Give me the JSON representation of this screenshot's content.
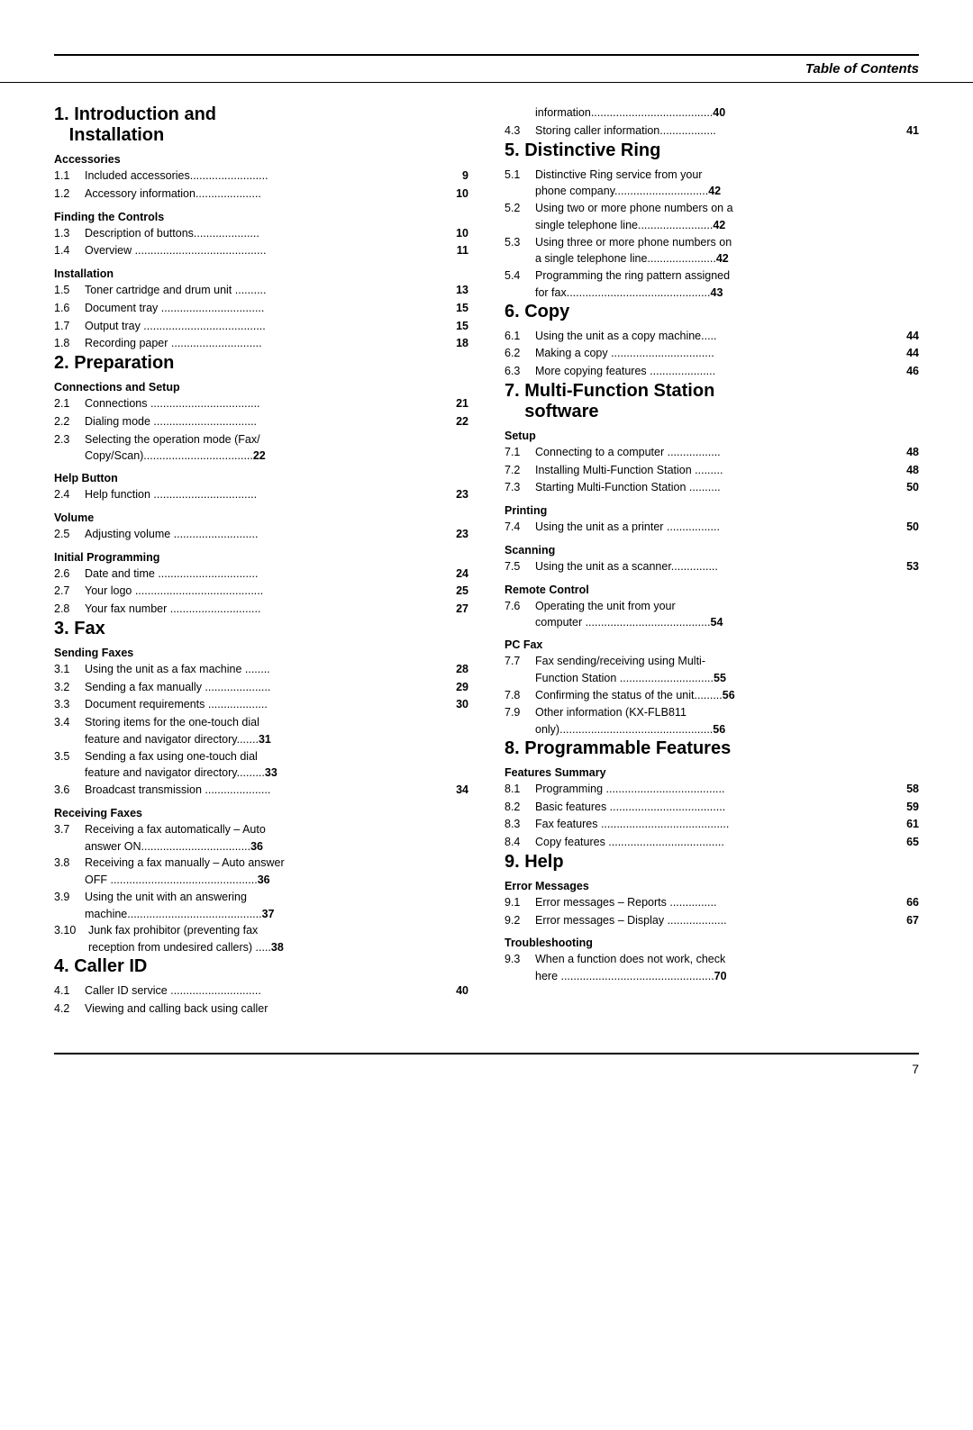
{
  "header": {
    "title": "Table of Contents"
  },
  "footer": {
    "page_number": "7"
  },
  "left_column": {
    "sections": [
      {
        "id": "section1",
        "number": "1.",
        "title": "Introduction and\n    Installation",
        "subsections": [
          {
            "label": "Accessories",
            "entries": [
              {
                "num": "1.1",
                "text": "Included accessories",
                "dots": ".........................",
                "page": "9"
              },
              {
                "num": "1.2",
                "text": "Accessory information",
                "dots": ".....................",
                "page": "10"
              }
            ]
          },
          {
            "label": "Finding the Controls",
            "entries": [
              {
                "num": "1.3",
                "text": "Description of buttons",
                "dots": ".....................",
                "page": "10"
              },
              {
                "num": "1.4",
                "text": "Overview",
                "dots": "....................................",
                "page": "11"
              }
            ]
          },
          {
            "label": "Installation",
            "entries": [
              {
                "num": "1.5",
                "text": "Toner cartridge and drum unit",
                "dots": ".........",
                "page": "13",
                "multiline": false
              },
              {
                "num": "1.6",
                "text": "Document tray",
                "dots": "............................",
                "page": "15"
              },
              {
                "num": "1.7",
                "text": "Output tray",
                "dots": "...............................",
                "page": "15"
              },
              {
                "num": "1.8",
                "text": "Recording paper",
                "dots": ".......................",
                "page": "18"
              }
            ]
          }
        ]
      },
      {
        "id": "section2",
        "number": "2.",
        "title": "Preparation",
        "subsections": [
          {
            "label": "Connections and Setup",
            "entries": [
              {
                "num": "2.1",
                "text": "Connections",
                "dots": ".................................",
                "page": "21"
              },
              {
                "num": "2.2",
                "text": "Dialing mode",
                "dots": "............................",
                "page": "22"
              },
              {
                "num": "2.3",
                "text": "Selecting the operation mode (Fax/\n        Copy/Scan)",
                "dots": "............................",
                "page": "22",
                "multiline": true
              }
            ]
          },
          {
            "label": "Help Button",
            "entries": [
              {
                "num": "2.4",
                "text": "Help function",
                "dots": "...............................",
                "page": "23"
              }
            ]
          },
          {
            "label": "Volume",
            "entries": [
              {
                "num": "2.5",
                "text": "Adjusting volume",
                "dots": ".....................",
                "page": "23"
              }
            ]
          },
          {
            "label": "Initial Programming",
            "entries": [
              {
                "num": "2.6",
                "text": "Date and time",
                "dots": "............................",
                "page": "24"
              },
              {
                "num": "2.7",
                "text": "Your logo",
                "dots": "...................................",
                "page": "25"
              },
              {
                "num": "2.8",
                "text": "Your fax number",
                "dots": ".....................",
                "page": "27"
              }
            ]
          }
        ]
      },
      {
        "id": "section3",
        "number": "3.",
        "title": "Fax",
        "subsections": [
          {
            "label": "Sending Faxes",
            "entries": [
              {
                "num": "3.1",
                "text": "Using the unit as a fax machine",
                "dots": ".......",
                "page": "28",
                "multiline": false
              },
              {
                "num": "3.2",
                "text": "Sending a fax manually",
                "dots": "...................",
                "page": "29"
              },
              {
                "num": "3.3",
                "text": "Document requirements",
                "dots": ".................",
                "page": "30"
              },
              {
                "num": "3.4",
                "text": "Storing items for the one-touch dial\n        feature and navigator directory",
                "dots": ".",
                "page": "31",
                "multiline": true
              },
              {
                "num": "3.5",
                "text": "Sending a fax using one-touch dial\n        feature and navigator directory",
                "dots": ".........",
                "page": "33",
                "multiline": true
              },
              {
                "num": "3.6",
                "text": "Broadcast transmission",
                "dots": ".................",
                "page": "34"
              }
            ]
          },
          {
            "label": "Receiving Faxes",
            "entries": [
              {
                "num": "3.7",
                "text": "Receiving a fax automatically – Auto\n        answer ON",
                "dots": ".................................",
                "page": "36",
                "multiline": true
              },
              {
                "num": "3.8",
                "text": "Receiving a fax manually – Auto answer\n        OFF",
                "dots": ".................................",
                "page": "36",
                "multiline": true
              },
              {
                "num": "3.9",
                "text": "Using the unit with an answering\n        machine",
                "dots": ".......................................",
                "page": "37",
                "multiline": true
              },
              {
                "num": "3.10",
                "text": "Junk fax prohibitor (preventing fax\n        reception from undesired callers)",
                "dots": ".....",
                "page": "38",
                "multiline": true
              }
            ]
          }
        ]
      },
      {
        "id": "section4",
        "number": "4.",
        "title": "Caller ID",
        "subsections": [
          {
            "label": "",
            "entries": [
              {
                "num": "4.1",
                "text": "Caller ID service",
                "dots": ".....................",
                "page": "40"
              },
              {
                "num": "4.2",
                "text": "Viewing and calling back using caller\n        information",
                "dots": "............................",
                "page": "40",
                "multiline": true
              }
            ]
          }
        ]
      }
    ]
  },
  "right_column": {
    "sections": [
      {
        "id": "section4cont",
        "entries_cont": [
          {
            "num": "4.3",
            "text": "Storing caller information",
            "dots": "................",
            "page": "41"
          }
        ]
      },
      {
        "id": "section5",
        "number": "5.",
        "title": "Distinctive Ring",
        "subsections": [
          {
            "label": "",
            "entries": [
              {
                "num": "5.1",
                "text": "Distinctive Ring service from your\n        phone company",
                "dots": ".......................",
                "page": "42",
                "multiline": true
              },
              {
                "num": "5.2",
                "text": "Using two or more phone numbers on a\n        single telephone line",
                "dots": "...................",
                "page": "42",
                "multiline": true
              },
              {
                "num": "5.3",
                "text": "Using three or more phone numbers on\n        a single telephone line",
                "dots": ".....................",
                "page": "42",
                "multiline": true
              },
              {
                "num": "5.4",
                "text": "Programming the ring pattern assigned\n        for fax",
                "dots": "...........................................",
                "page": "43",
                "multiline": true
              }
            ]
          }
        ]
      },
      {
        "id": "section6",
        "number": "6.",
        "title": "Copy",
        "subsections": [
          {
            "label": "",
            "entries": [
              {
                "num": "6.1",
                "text": "Using the unit as a copy machine",
                "dots": ".....",
                "page": "44"
              },
              {
                "num": "6.2",
                "text": "Making a copy",
                "dots": "............................",
                "page": "44"
              },
              {
                "num": "6.3",
                "text": "More copying features",
                "dots": "...................",
                "page": "46"
              }
            ]
          }
        ]
      },
      {
        "id": "section7",
        "number": "7.",
        "title": "Multi-Function Station\n    software",
        "subsections": [
          {
            "label": "Setup",
            "entries": [
              {
                "num": "7.1",
                "text": "Connecting to a computer",
                "dots": ".............",
                "page": "48"
              },
              {
                "num": "7.2",
                "text": "Installing Multi-Function Station",
                "dots": ".......",
                "page": "48"
              },
              {
                "num": "7.3",
                "text": "Starting Multi-Function Station",
                "dots": ".........",
                "page": "50"
              }
            ]
          },
          {
            "label": "Printing",
            "entries": [
              {
                "num": "7.4",
                "text": "Using the unit as a printer",
                "dots": ".............",
                "page": "50"
              }
            ]
          },
          {
            "label": "Scanning",
            "entries": [
              {
                "num": "7.5",
                "text": "Using the unit as a scanner",
                "dots": "...........",
                "page": "53"
              }
            ]
          },
          {
            "label": "Remote Control",
            "entries": [
              {
                "num": "7.6",
                "text": "Operating the unit from your\n        computer",
                "dots": ".................................",
                "page": "54",
                "multiline": true
              }
            ]
          },
          {
            "label": "PC Fax",
            "entries": [
              {
                "num": "7.7",
                "text": "Fax sending/receiving using Multi-\n        Function Station",
                "dots": ".......................",
                "page": "55",
                "multiline": true
              },
              {
                "num": "7.8",
                "text": "Confirming the status of the unit",
                "dots": ".......",
                "page": "56"
              },
              {
                "num": "7.9",
                "text": "Other information (KX-FLB811\n        only)",
                "dots": "...........................................",
                "page": "56",
                "multiline": true
              }
            ]
          }
        ]
      },
      {
        "id": "section8",
        "number": "8.",
        "title": "Programmable Features",
        "subsections": [
          {
            "label": "Features Summary",
            "entries": [
              {
                "num": "8.1",
                "text": "Programming",
                "dots": "............................",
                "page": "58"
              },
              {
                "num": "8.2",
                "text": "Basic features",
                "dots": "...........................",
                "page": "59"
              },
              {
                "num": "8.3",
                "text": "Fax features",
                "dots": ".............................",
                "page": "61"
              },
              {
                "num": "8.4",
                "text": "Copy features",
                "dots": "...........................",
                "page": "65"
              }
            ]
          }
        ]
      },
      {
        "id": "section9",
        "number": "9.",
        "title": "Help",
        "subsections": [
          {
            "label": "Error Messages",
            "entries": [
              {
                "num": "9.1",
                "text": "Error messages – Reports",
                "dots": "...........",
                "page": "66"
              },
              {
                "num": "9.2",
                "text": "Error messages – Display",
                "dots": "...............",
                "page": "67"
              }
            ]
          },
          {
            "label": "Troubleshooting",
            "entries": [
              {
                "num": "9.3",
                "text": "When a function does not work, check\n        here",
                "dots": "...........................................",
                "page": "70",
                "multiline": true
              }
            ]
          }
        ]
      }
    ]
  }
}
